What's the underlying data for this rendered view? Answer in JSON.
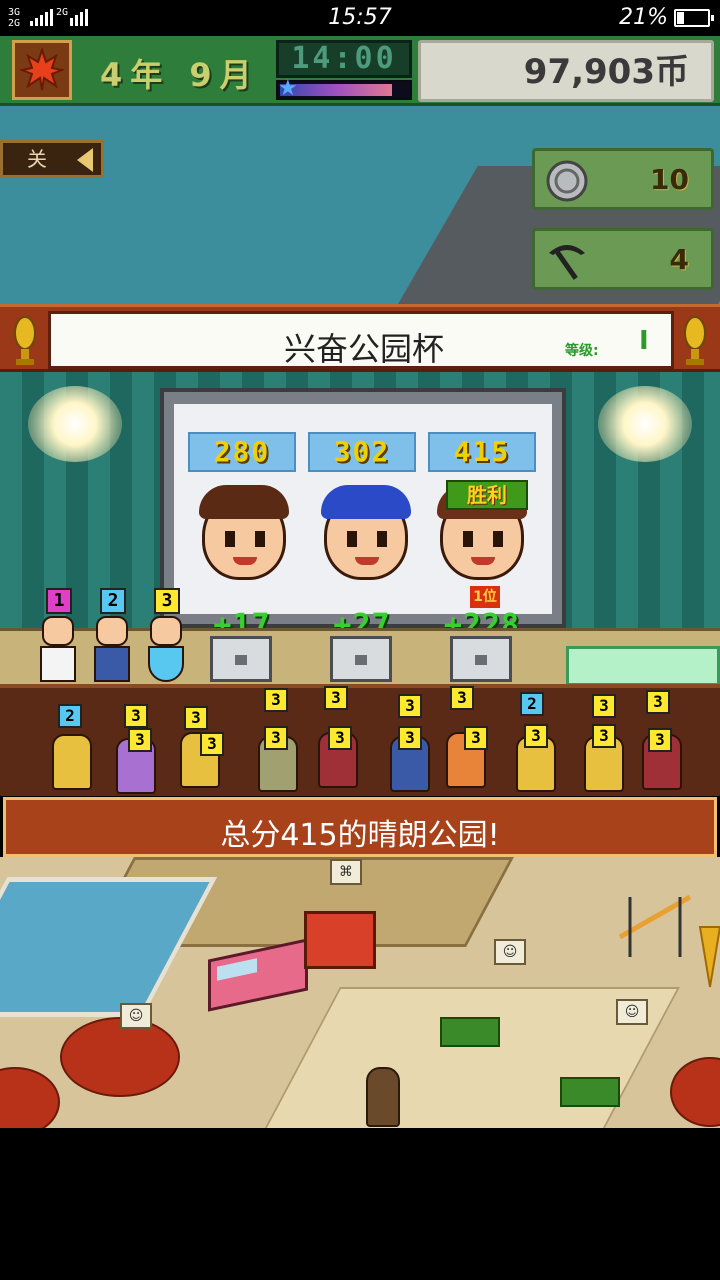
{
  "status_bar": {
    "network1": "3G",
    "network2": "2G",
    "network3": "2G",
    "time": "15:57",
    "battery_percent": "21%",
    "battery_level": 0.21
  },
  "hud": {
    "year_month": "4年 9月",
    "clock": "14:00",
    "day_progress": 0.88,
    "money": "97,903币"
  },
  "side": {
    "close_label": "关",
    "medals_value": "10",
    "pickaxe_value": "4"
  },
  "banner": {
    "title": "兴奋公园杯",
    "rank_label": "等级:",
    "rank_value": "I"
  },
  "scoreboard": {
    "scores": [
      "280",
      "302",
      "415"
    ],
    "bonuses": [
      "+17",
      "+27",
      "+228"
    ],
    "victory_label": "胜利",
    "first_place_badge": "1位"
  },
  "contestants": {
    "places": [
      "1",
      "2",
      "3"
    ]
  },
  "audience": {
    "badges": [
      "2",
      "3",
      "3",
      "3",
      "3",
      "3",
      "3",
      "2",
      "3",
      "3",
      "3",
      "3",
      "3",
      "3",
      "3",
      "3",
      "3",
      "3",
      "3"
    ]
  },
  "message": "总分415的晴朗公园!",
  "colors": {
    "hud_green": "#2f7d3a",
    "banner_red": "#9a3818",
    "bonus_green": "#38d030",
    "score_yellow": "#f0d000",
    "badge_magenta": "#e040c8",
    "badge_cyan": "#58c8f0",
    "badge_yellow": "#ffe830"
  },
  "icons": {
    "logo": "maple-leaf-icon",
    "medals": "silver-coin-icon",
    "pickaxe": "pickaxe-icon",
    "trophy": "golden-trophy-icon",
    "close": "arrow-left-icon"
  }
}
